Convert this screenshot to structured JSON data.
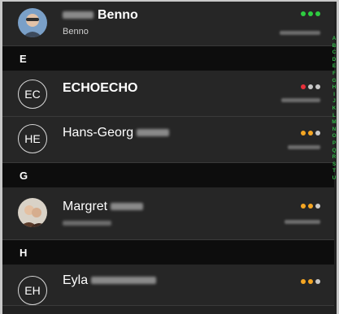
{
  "colors": {
    "dot_green": "#2ecc40",
    "dot_red": "#e8303a",
    "dot_orange": "#f5a623",
    "dot_grey": "#c8c8c8",
    "index_green": "#33b94a"
  },
  "contacts_top": {
    "name": "Benno",
    "subtitle": "Benno",
    "avatar": "photo-avatar",
    "status_dots": [
      "green",
      "green",
      "green"
    ]
  },
  "sections": [
    {
      "letter": "E",
      "contacts": [
        {
          "initials": "EC",
          "name": "ECHOECHO",
          "status_dots": [
            "red",
            "grey",
            "grey"
          ]
        },
        {
          "initials": "HE",
          "name": "Hans-Georg",
          "status_dots": [
            "orange",
            "orange",
            "grey"
          ]
        }
      ]
    },
    {
      "letter": "G",
      "contacts": [
        {
          "initials": "",
          "name": "Margret",
          "avatar": "photo-avatar",
          "status_dots": [
            "orange",
            "orange",
            "grey"
          ]
        }
      ]
    },
    {
      "letter": "H",
      "contacts": [
        {
          "initials": "EH",
          "name": "Eyla",
          "status_dots": [
            "orange",
            "orange",
            "grey"
          ]
        }
      ]
    }
  ],
  "alphabet_index": [
    "A",
    "B",
    "C",
    "D",
    "E",
    "F",
    "G",
    "H",
    "I",
    "J",
    "K",
    "L",
    "M",
    "N",
    "O",
    "P",
    "Q",
    "R",
    "S",
    "T",
    "U"
  ]
}
